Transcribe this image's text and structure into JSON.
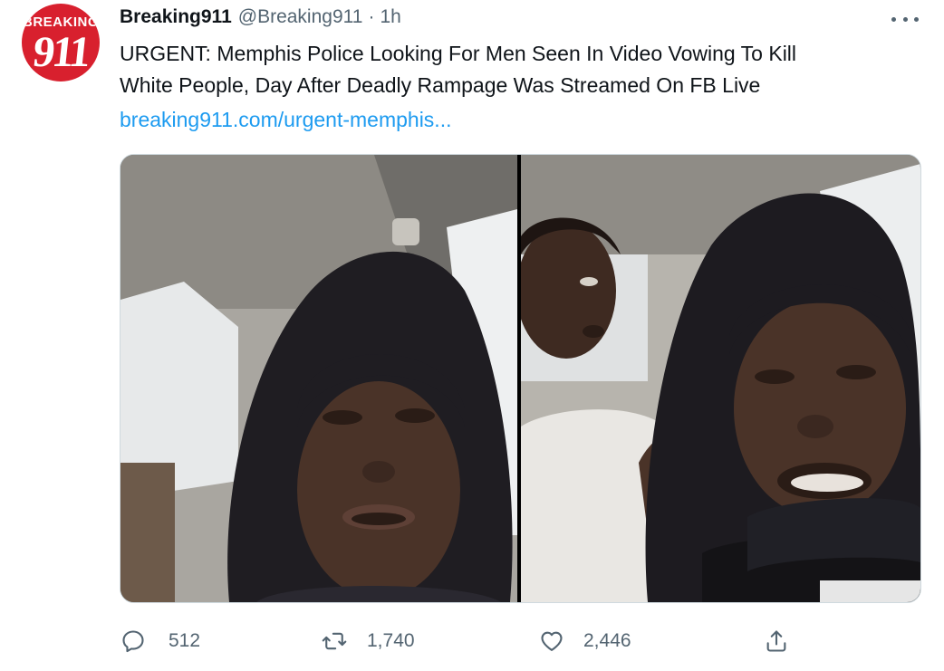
{
  "author": {
    "avatar_text_top": "BREAKING",
    "avatar_text_big": "911",
    "display_name": "Breaking911",
    "handle": "@Breaking911",
    "separator": "·",
    "time": "1h"
  },
  "tweet": {
    "text": "URGENT: Memphis Police Looking For Men Seen In Video Vowing To Kill\nWhite People, Day After Deadly Rampage Was Streamed On FB Live",
    "link": "breaking911.com/urgent-memphis..."
  },
  "actions": {
    "reply": {
      "icon": "reply-icon",
      "count": "512"
    },
    "retweet": {
      "icon": "retweet-icon",
      "count": "1,740"
    },
    "like": {
      "icon": "heart-icon",
      "count": "2,446"
    },
    "share": {
      "icon": "share-icon"
    }
  },
  "colors": {
    "brand_red": "#d8202e",
    "link_blue": "#1d9bf0",
    "muted_gray": "#536471",
    "text": "#0f1419"
  }
}
